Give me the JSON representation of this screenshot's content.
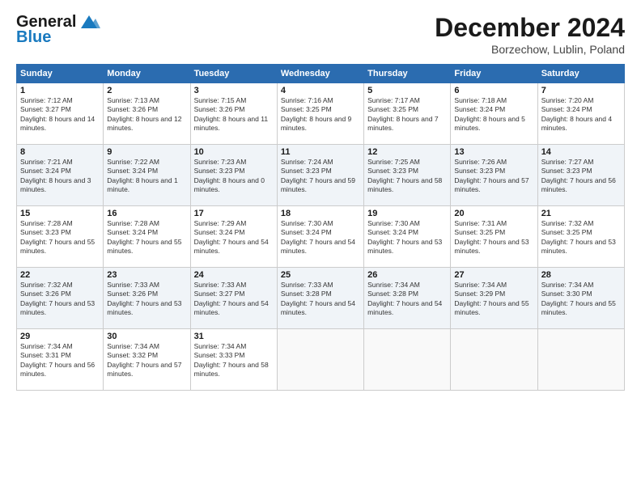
{
  "header": {
    "logo_line1": "General",
    "logo_line2": "Blue",
    "month": "December 2024",
    "location": "Borzechow, Lublin, Poland"
  },
  "days_of_week": [
    "Sunday",
    "Monday",
    "Tuesday",
    "Wednesday",
    "Thursday",
    "Friday",
    "Saturday"
  ],
  "weeks": [
    [
      {
        "day": "1",
        "sunrise": "7:12 AM",
        "sunset": "3:27 PM",
        "daylight": "8 hours and 14 minutes."
      },
      {
        "day": "2",
        "sunrise": "7:13 AM",
        "sunset": "3:26 PM",
        "daylight": "8 hours and 12 minutes."
      },
      {
        "day": "3",
        "sunrise": "7:15 AM",
        "sunset": "3:26 PM",
        "daylight": "8 hours and 11 minutes."
      },
      {
        "day": "4",
        "sunrise": "7:16 AM",
        "sunset": "3:25 PM",
        "daylight": "8 hours and 9 minutes."
      },
      {
        "day": "5",
        "sunrise": "7:17 AM",
        "sunset": "3:25 PM",
        "daylight": "8 hours and 7 minutes."
      },
      {
        "day": "6",
        "sunrise": "7:18 AM",
        "sunset": "3:24 PM",
        "daylight": "8 hours and 5 minutes."
      },
      {
        "day": "7",
        "sunrise": "7:20 AM",
        "sunset": "3:24 PM",
        "daylight": "8 hours and 4 minutes."
      }
    ],
    [
      {
        "day": "8",
        "sunrise": "7:21 AM",
        "sunset": "3:24 PM",
        "daylight": "8 hours and 3 minutes."
      },
      {
        "day": "9",
        "sunrise": "7:22 AM",
        "sunset": "3:24 PM",
        "daylight": "8 hours and 1 minute."
      },
      {
        "day": "10",
        "sunrise": "7:23 AM",
        "sunset": "3:23 PM",
        "daylight": "8 hours and 0 minutes."
      },
      {
        "day": "11",
        "sunrise": "7:24 AM",
        "sunset": "3:23 PM",
        "daylight": "7 hours and 59 minutes."
      },
      {
        "day": "12",
        "sunrise": "7:25 AM",
        "sunset": "3:23 PM",
        "daylight": "7 hours and 58 minutes."
      },
      {
        "day": "13",
        "sunrise": "7:26 AM",
        "sunset": "3:23 PM",
        "daylight": "7 hours and 57 minutes."
      },
      {
        "day": "14",
        "sunrise": "7:27 AM",
        "sunset": "3:23 PM",
        "daylight": "7 hours and 56 minutes."
      }
    ],
    [
      {
        "day": "15",
        "sunrise": "7:28 AM",
        "sunset": "3:23 PM",
        "daylight": "7 hours and 55 minutes."
      },
      {
        "day": "16",
        "sunrise": "7:28 AM",
        "sunset": "3:24 PM",
        "daylight": "7 hours and 55 minutes."
      },
      {
        "day": "17",
        "sunrise": "7:29 AM",
        "sunset": "3:24 PM",
        "daylight": "7 hours and 54 minutes."
      },
      {
        "day": "18",
        "sunrise": "7:30 AM",
        "sunset": "3:24 PM",
        "daylight": "7 hours and 54 minutes."
      },
      {
        "day": "19",
        "sunrise": "7:30 AM",
        "sunset": "3:24 PM",
        "daylight": "7 hours and 53 minutes."
      },
      {
        "day": "20",
        "sunrise": "7:31 AM",
        "sunset": "3:25 PM",
        "daylight": "7 hours and 53 minutes."
      },
      {
        "day": "21",
        "sunrise": "7:32 AM",
        "sunset": "3:25 PM",
        "daylight": "7 hours and 53 minutes."
      }
    ],
    [
      {
        "day": "22",
        "sunrise": "7:32 AM",
        "sunset": "3:26 PM",
        "daylight": "7 hours and 53 minutes."
      },
      {
        "day": "23",
        "sunrise": "7:33 AM",
        "sunset": "3:26 PM",
        "daylight": "7 hours and 53 minutes."
      },
      {
        "day": "24",
        "sunrise": "7:33 AM",
        "sunset": "3:27 PM",
        "daylight": "7 hours and 54 minutes."
      },
      {
        "day": "25",
        "sunrise": "7:33 AM",
        "sunset": "3:28 PM",
        "daylight": "7 hours and 54 minutes."
      },
      {
        "day": "26",
        "sunrise": "7:34 AM",
        "sunset": "3:28 PM",
        "daylight": "7 hours and 54 minutes."
      },
      {
        "day": "27",
        "sunrise": "7:34 AM",
        "sunset": "3:29 PM",
        "daylight": "7 hours and 55 minutes."
      },
      {
        "day": "28",
        "sunrise": "7:34 AM",
        "sunset": "3:30 PM",
        "daylight": "7 hours and 55 minutes."
      }
    ],
    [
      {
        "day": "29",
        "sunrise": "7:34 AM",
        "sunset": "3:31 PM",
        "daylight": "7 hours and 56 minutes."
      },
      {
        "day": "30",
        "sunrise": "7:34 AM",
        "sunset": "3:32 PM",
        "daylight": "7 hours and 57 minutes."
      },
      {
        "day": "31",
        "sunrise": "7:34 AM",
        "sunset": "3:33 PM",
        "daylight": "7 hours and 58 minutes."
      },
      null,
      null,
      null,
      null
    ]
  ]
}
